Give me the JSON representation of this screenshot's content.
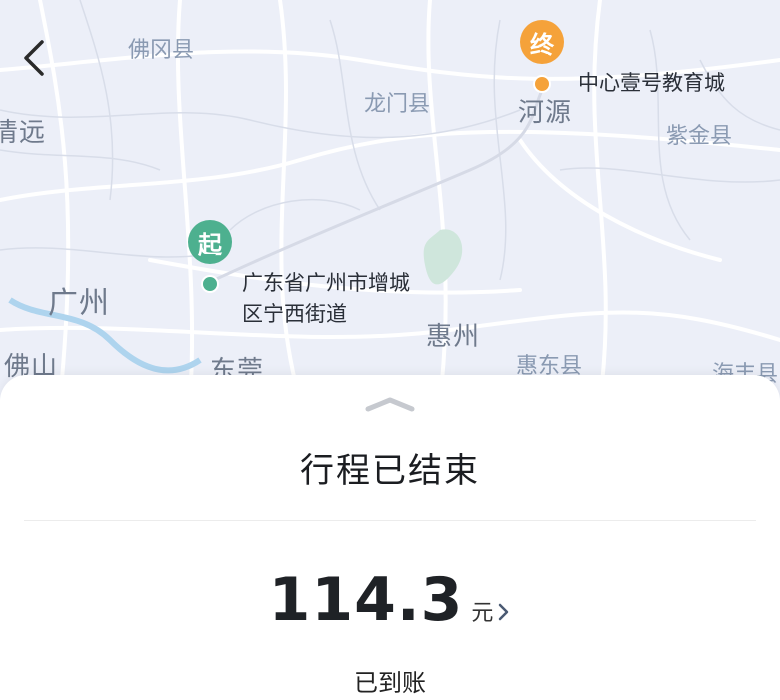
{
  "map": {
    "cities": [
      "佛冈县",
      "龙门县",
      "河源",
      "紫金县",
      "清远",
      "广州",
      "佛山",
      "东莞",
      "惠州",
      "惠东县",
      "海丰县"
    ],
    "start": {
      "badge": "起",
      "address_line1": "广东省广州市增城",
      "address_line2": "区宁西街道",
      "color": "#4db08f"
    },
    "end": {
      "badge": "终",
      "address": "中心壹号教育城",
      "color": "#f5a23a"
    }
  },
  "trip": {
    "status": "行程已结束",
    "amount": "114.3",
    "unit": "元",
    "payment_status": "已到账"
  }
}
